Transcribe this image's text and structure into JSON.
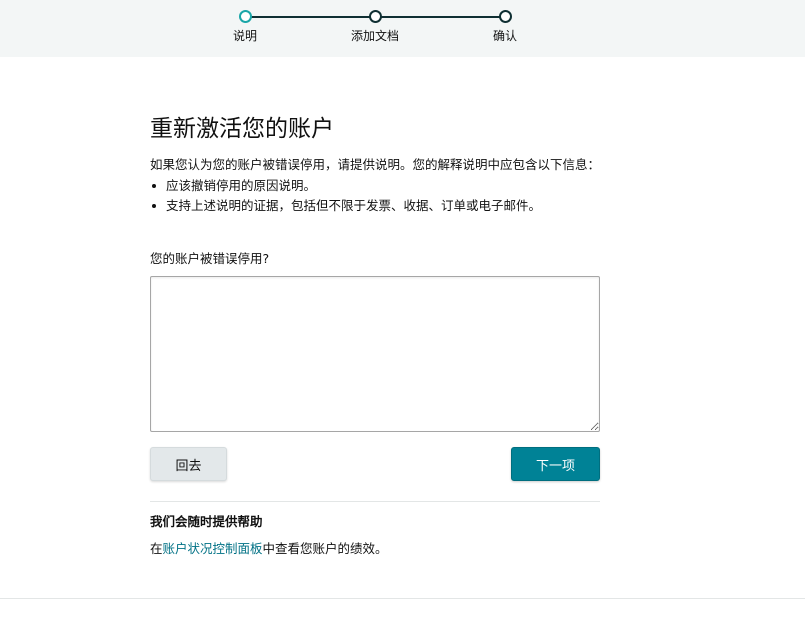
{
  "stepper": {
    "steps": [
      {
        "label": "说明",
        "state": "active"
      },
      {
        "label": "添加文档",
        "state": "pending"
      },
      {
        "label": "确认",
        "state": "pending"
      }
    ],
    "active_color": "#1aa6a8",
    "track_color": "#0f2f33"
  },
  "page": {
    "title": "重新激活您的账户",
    "intro": "如果您认为您的账户被错误停用，请提供说明。您的解释说明中应包含以下信息：",
    "bullets": [
      "应该撤销停用的原因说明。",
      "支持上述说明的证据，包括但不限于发票、收据、订单或电子邮件。"
    ],
    "question_label": "您的账户被错误停用?",
    "answer_value": ""
  },
  "buttons": {
    "back_label": "回去",
    "next_label": "下一项",
    "next_color": "#008296"
  },
  "help": {
    "title": "我们会随时提供帮助",
    "text_prefix": "在",
    "link_label": "账户状况控制面板",
    "text_suffix": "中查看您账户的绩效。",
    "link_color": "#007185"
  }
}
